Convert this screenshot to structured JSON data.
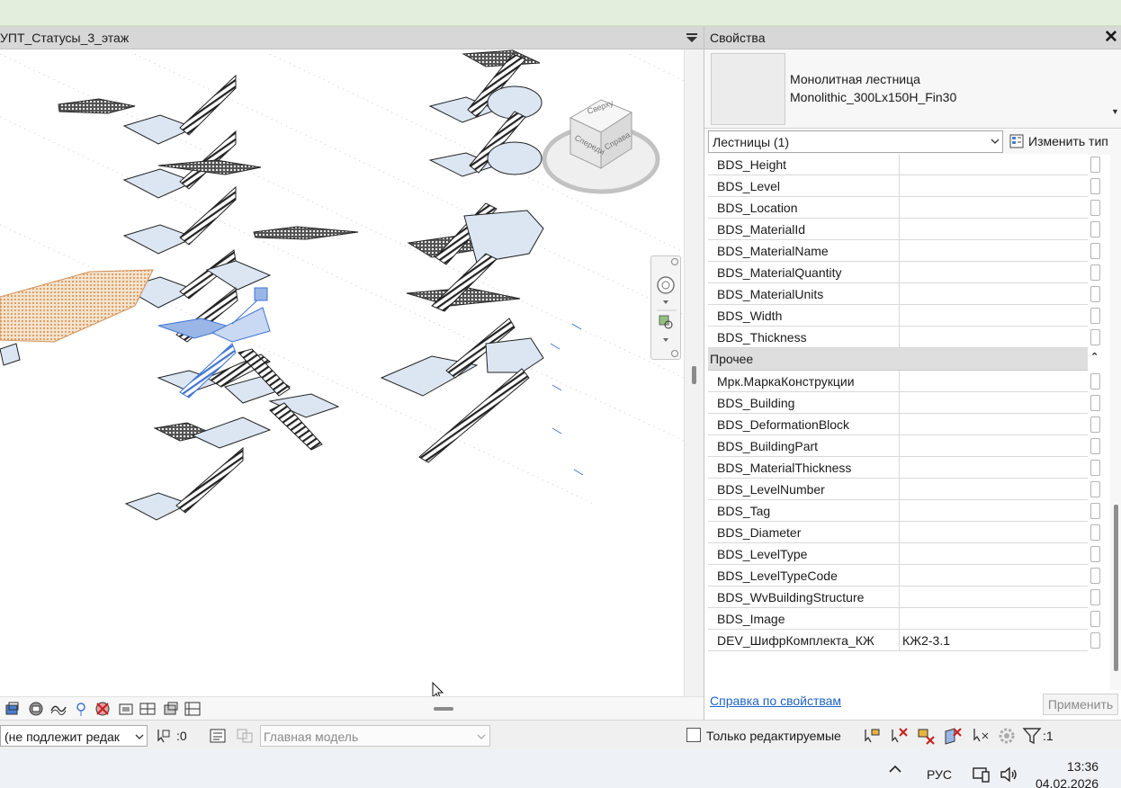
{
  "view": {
    "title": "УПТ_Статусы_3_этаж",
    "viewcube": {
      "top_label": "Сверху",
      "front_label": "Спереди",
      "right_label": "Справа"
    }
  },
  "properties": {
    "title": "Свойства",
    "close_icon": "close-icon",
    "type": {
      "family": "Монолитная лестница",
      "type_name": "Monolithic_300Lx150H_Fin30"
    },
    "filter": {
      "selected": "Лестницы (1)"
    },
    "edit_type_label": "Изменить тип",
    "rows_top": [
      {
        "name": "BDS_Height",
        "value": ""
      },
      {
        "name": "BDS_Level",
        "value": ""
      },
      {
        "name": "BDS_Location",
        "value": ""
      },
      {
        "name": "BDS_MaterialId",
        "value": ""
      },
      {
        "name": "BDS_MaterialName",
        "value": ""
      },
      {
        "name": "BDS_MaterialQuantity",
        "value": ""
      },
      {
        "name": "BDS_MaterialUnits",
        "value": ""
      },
      {
        "name": "BDS_Width",
        "value": ""
      },
      {
        "name": "BDS_Thickness",
        "value": ""
      }
    ],
    "group_other": {
      "label": "Прочее",
      "toggle": "⌃"
    },
    "rows_other": [
      {
        "name": "Мрк.МаркаКонструкции",
        "value": ""
      },
      {
        "name": "BDS_Building",
        "value": ""
      },
      {
        "name": "BDS_DeformationBlock",
        "value": ""
      },
      {
        "name": "BDS_BuildingPart",
        "value": ""
      },
      {
        "name": "BDS_MaterialThickness",
        "value": ""
      },
      {
        "name": "BDS_LevelNumber",
        "value": ""
      },
      {
        "name": "BDS_Tag",
        "value": ""
      },
      {
        "name": "BDS_Diameter",
        "value": ""
      },
      {
        "name": "BDS_LevelType",
        "value": ""
      },
      {
        "name": "BDS_LevelTypeCode",
        "value": ""
      },
      {
        "name": "BDS_WvBuildingStructure",
        "value": ""
      },
      {
        "name": "BDS_Image",
        "value": ""
      },
      {
        "name": "DEV_ШифрКомплекта_КЖ",
        "value": "КЖ2-3.1"
      }
    ],
    "help_link": "Справка по свойствам",
    "apply_label": "Применить"
  },
  "statusbar": {
    "workset": "(не подлежит редак",
    "selection_count": ":0",
    "model": "Главная модель",
    "editable_only": "Только редактируемые",
    "filter_count": ":1"
  },
  "taskbar": {
    "language": "РУС",
    "time": "13:36",
    "date": "04.02.2026"
  },
  "colors": {
    "accent_selection": "#3f74d2",
    "link": "#1e64c8",
    "title_band": "#e3efdc"
  }
}
